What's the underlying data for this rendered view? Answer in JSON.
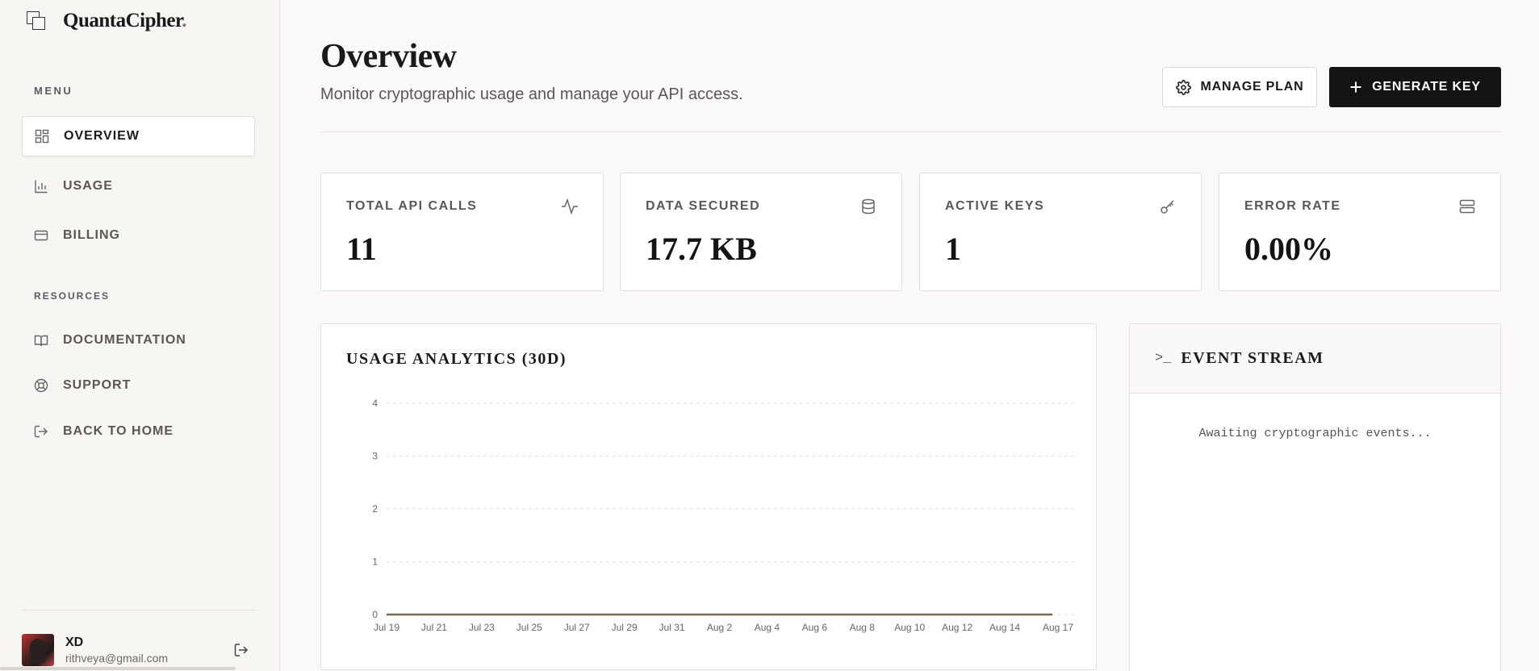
{
  "brand": {
    "name": "QuantaCipher",
    "dot": "."
  },
  "sidebar": {
    "menu_label": "MENU",
    "menu_items": [
      {
        "label": "OVERVIEW",
        "icon": "grid-icon",
        "active": true
      },
      {
        "label": "USAGE",
        "icon": "bar-chart-icon",
        "active": false
      },
      {
        "label": "BILLING",
        "icon": "credit-card-icon",
        "active": false
      }
    ],
    "resources_label": "RESOURCES",
    "resource_items": [
      {
        "label": "DOCUMENTATION",
        "icon": "book-icon"
      },
      {
        "label": "SUPPORT",
        "icon": "lifebuoy-icon"
      },
      {
        "label": "BACK TO HOME",
        "icon": "exit-icon"
      }
    ],
    "user": {
      "name": "XD",
      "email": "rithveya@gmail.com"
    }
  },
  "header": {
    "title": "Overview",
    "subtitle": "Monitor cryptographic usage and manage your API access.",
    "manage_plan_label": "MANAGE PLAN",
    "generate_key_label": "GENERATE KEY"
  },
  "stats": [
    {
      "label": "TOTAL API CALLS",
      "value": "11",
      "icon": "activity-icon"
    },
    {
      "label": "DATA SECURED",
      "value": "17.7 KB",
      "icon": "database-icon"
    },
    {
      "label": "ACTIVE KEYS",
      "value": "1",
      "icon": "key-icon"
    },
    {
      "label": "ERROR RATE",
      "value": "0.00%",
      "icon": "server-icon"
    }
  ],
  "usage_panel": {
    "title": "USAGE ANALYTICS (30D)"
  },
  "chart_data": {
    "type": "line",
    "title": "USAGE ANALYTICS (30D)",
    "x": [
      "Jul 19",
      "Jul 21",
      "Jul 23",
      "Jul 25",
      "Jul 27",
      "Jul 29",
      "Jul 31",
      "Aug 2",
      "Aug 4",
      "Aug 6",
      "Aug 8",
      "Aug 10",
      "Aug 12",
      "Aug 14",
      "Aug 17"
    ],
    "series": [
      {
        "values": [
          0,
          0,
          0,
          0,
          0,
          0,
          0,
          0,
          0,
          0,
          0,
          0,
          0,
          0,
          0
        ]
      }
    ],
    "yticks": [
      "0",
      "1",
      "2",
      "3",
      "4"
    ],
    "ylim": [
      0,
      4
    ],
    "grid": true,
    "line_color": "#7a6a50"
  },
  "event_stream": {
    "title": "EVENT STREAM",
    "prompt": ">_",
    "empty_text": "Awaiting cryptographic events..."
  }
}
